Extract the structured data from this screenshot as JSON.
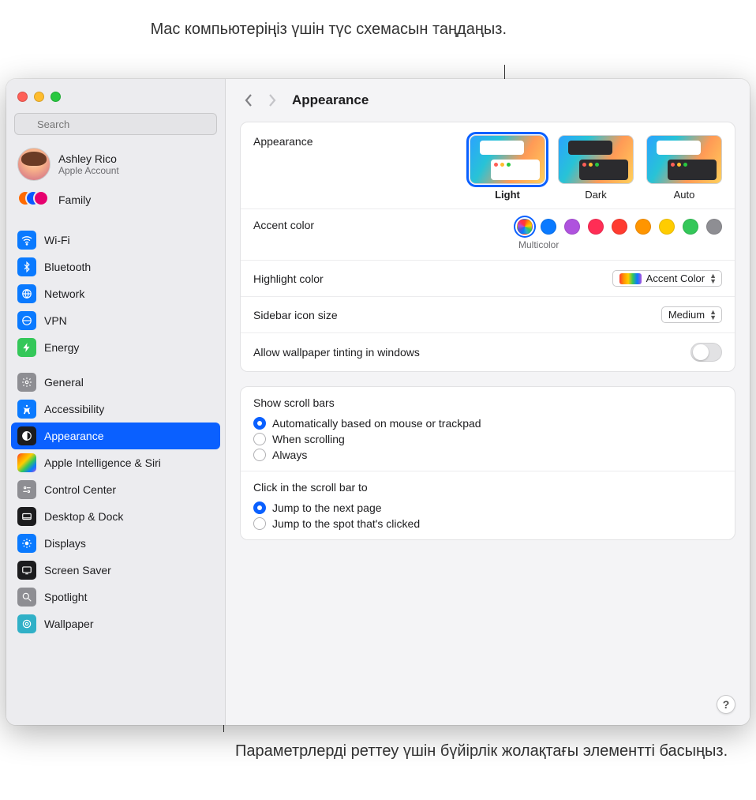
{
  "callouts": {
    "top": "Mac компьютеріңіз үшін түс схемасын таңдаңыз.",
    "bottom": "Параметрлерді реттеу үшін бүйірлік жолақтағы элементті басыңыз."
  },
  "search": {
    "placeholder": "Search"
  },
  "account": {
    "name": "Ashley Rico",
    "sub": "Apple Account"
  },
  "family": {
    "label": "Family"
  },
  "sidebar": {
    "items": [
      {
        "label": "Wi-Fi"
      },
      {
        "label": "Bluetooth"
      },
      {
        "label": "Network"
      },
      {
        "label": "VPN"
      },
      {
        "label": "Energy"
      },
      {
        "label": "General"
      },
      {
        "label": "Accessibility"
      },
      {
        "label": "Appearance"
      },
      {
        "label": "Apple Intelligence & Siri"
      },
      {
        "label": "Control Center"
      },
      {
        "label": "Desktop & Dock"
      },
      {
        "label": "Displays"
      },
      {
        "label": "Screen Saver"
      },
      {
        "label": "Spotlight"
      },
      {
        "label": "Wallpaper"
      }
    ]
  },
  "toolbar": {
    "title": "Appearance"
  },
  "appearance": {
    "label": "Appearance",
    "options": {
      "light": "Light",
      "dark": "Dark",
      "auto": "Auto"
    },
    "selected": "Light"
  },
  "accent": {
    "label": "Accent color",
    "selected_name": "Multicolor"
  },
  "highlight": {
    "label": "Highlight color",
    "value": "Accent Color"
  },
  "sidebar_icon": {
    "label": "Sidebar icon size",
    "value": "Medium"
  },
  "tinting": {
    "label": "Allow wallpaper tinting in windows",
    "on": false
  },
  "scroll_bars": {
    "title": "Show scroll bars",
    "options": {
      "auto": "Automatically based on mouse or trackpad",
      "scrolling": "When scrolling",
      "always": "Always"
    },
    "selected": "auto"
  },
  "click_scroll": {
    "title": "Click in the scroll bar to",
    "options": {
      "next": "Jump to the next page",
      "spot": "Jump to the spot that's clicked"
    },
    "selected": "next"
  },
  "help": {
    "glyph": "?"
  }
}
